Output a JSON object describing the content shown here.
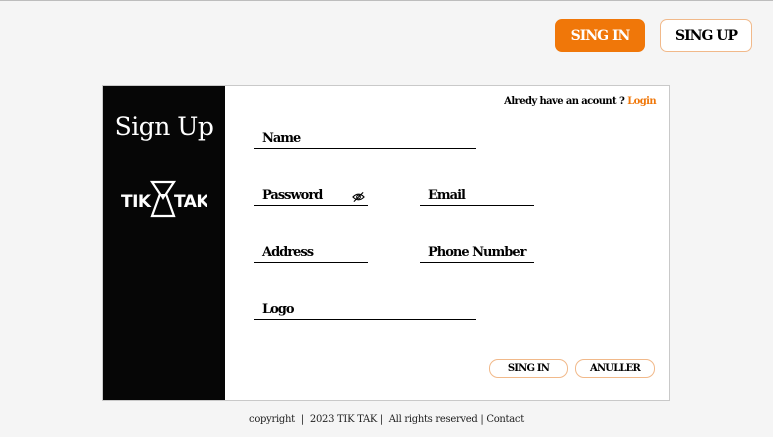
{
  "topnav": {
    "signin_label": "SING IN",
    "signup_label": "SING UP"
  },
  "sidebar": {
    "title": "Sign Up",
    "logo_text": "TIK TAK",
    "logo_left": "TIK",
    "logo_right": "TAK"
  },
  "form": {
    "already_text": "Alredy have an acount ?",
    "login_link": "Login",
    "fields": {
      "name": "Name",
      "password": "Password",
      "email": "Email",
      "address": "Address",
      "phone": "Phone Number",
      "logo": "Logo"
    },
    "signin_label": "SING IN",
    "annuler_label": "ANULLER"
  },
  "footer": {
    "copyright": "copyright",
    "sep1": "|",
    "year_brand": "2023 TIK TAK |",
    "rights": "All rights reserved |",
    "contact": "Contact"
  },
  "colors": {
    "accent": "#f07709",
    "sidebar_bg": "#060606",
    "page_bg": "#f5f5f5"
  }
}
